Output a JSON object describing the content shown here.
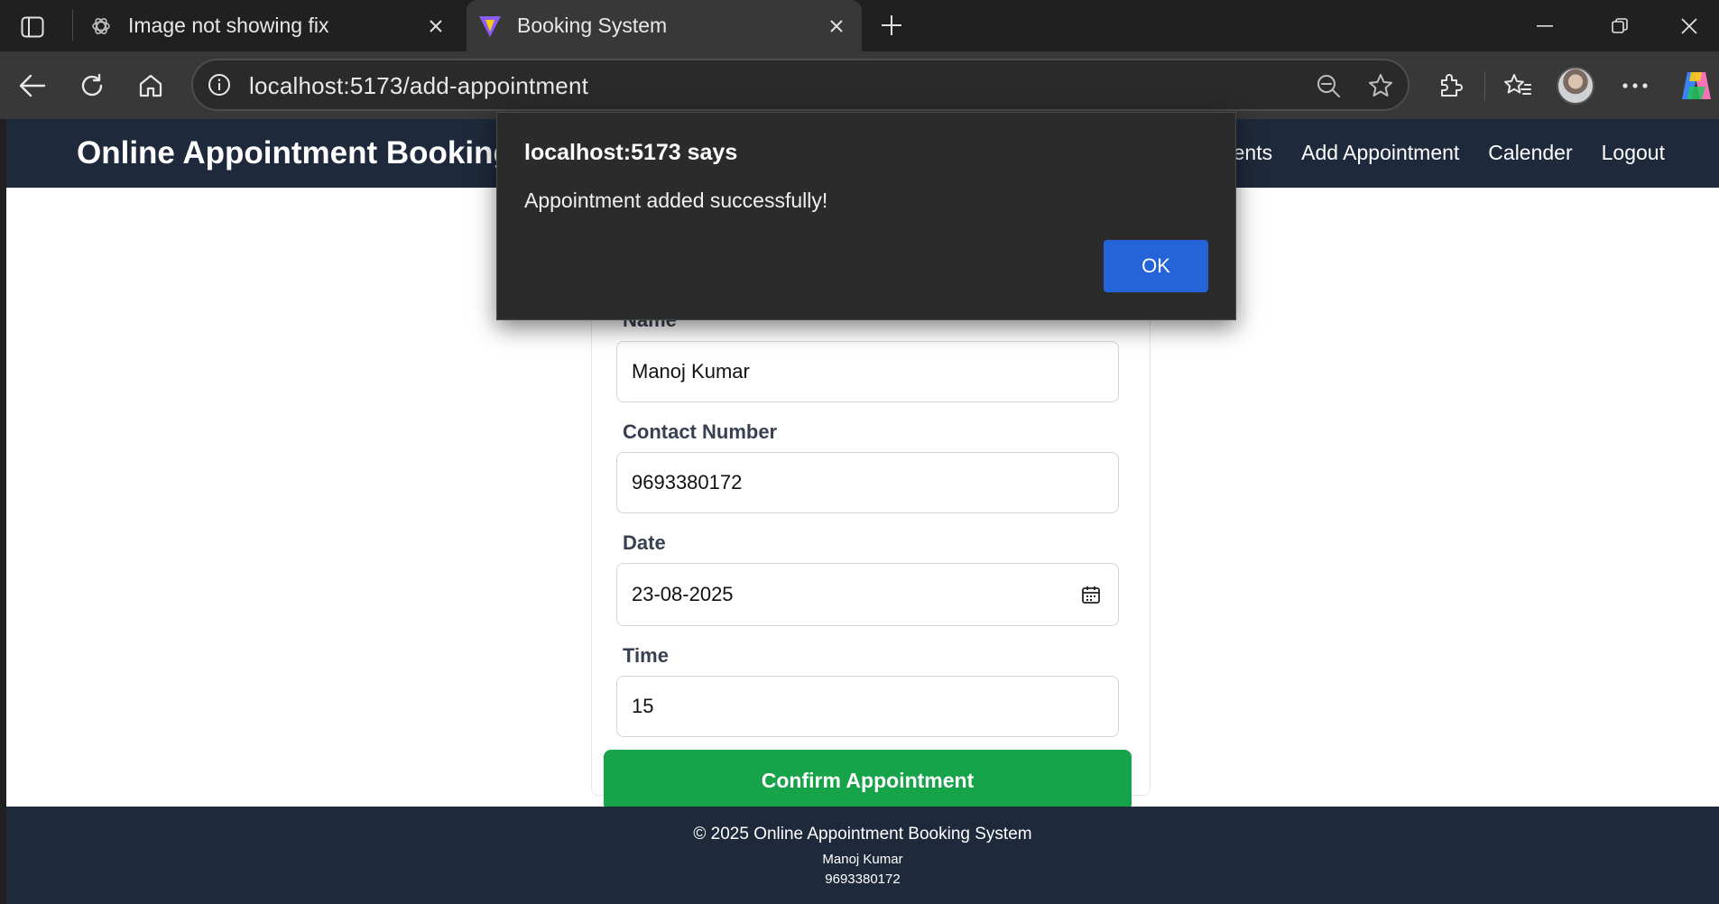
{
  "browser": {
    "tabs": [
      {
        "title": "Image not showing fix",
        "active": false,
        "icon": "chatgpt-icon"
      },
      {
        "title": "Booking System",
        "active": true,
        "icon": "vite-icon"
      }
    ],
    "url": "localhost:5173/add-appointment"
  },
  "app": {
    "brand": "Online Appointment Booking System",
    "nav": [
      "Appointments",
      "Add Appointment",
      "Calender",
      "Logout"
    ]
  },
  "form": {
    "name_label": "Name",
    "name_value": "Manoj Kumar",
    "contact_label": "Contact Number",
    "contact_value": "9693380172",
    "date_label": "Date",
    "date_value": "23-08-2025",
    "time_label": "Time",
    "time_value": "15",
    "submit_label": "Confirm Appointment"
  },
  "footer": {
    "copyright": "© 2025 Online Appointment Booking System",
    "name": "Manoj Kumar",
    "phone": "9693380172"
  },
  "dialog": {
    "title": "localhost:5173 says",
    "message": "Appointment added successfully!",
    "ok_label": "OK"
  },
  "colors": {
    "nav_bg": "#1e293b",
    "confirm_button": "#16a34a",
    "dialog_ok": "#2563d8"
  }
}
